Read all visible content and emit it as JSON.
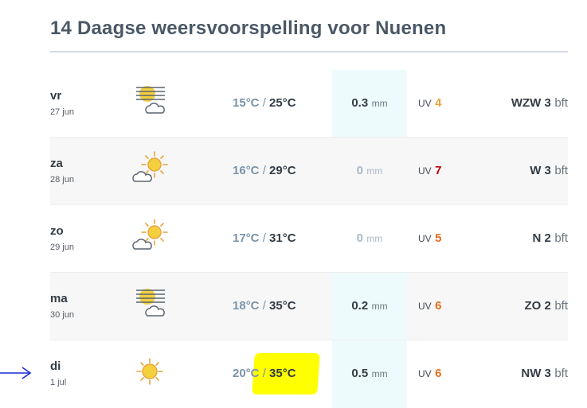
{
  "title": "14 Daagse weersvoorspelling voor Nuenen",
  "units": {
    "temp": "°C",
    "rain": "mm",
    "uv": "UV",
    "wind": "bft",
    "slash": "/"
  },
  "colors": {
    "uv_moderate": "#e8a33b",
    "uv_high": "#e07020",
    "uv_very_high": "#c0000a",
    "highlight": "#ffff00",
    "arrow": "#1c2bd6"
  },
  "days": [
    {
      "day": "vr",
      "date": "27 jun",
      "icon": "haze-cloud-icon",
      "tmin": "15",
      "tmax": "25",
      "rain": "0.3",
      "uv": "4",
      "uv_color": "#e8a33b",
      "wind": "WZW 3"
    },
    {
      "day": "za",
      "date": "28 jun",
      "icon": "sun-cloud-icon",
      "tmin": "16",
      "tmax": "29",
      "rain": "0",
      "uv": "7",
      "uv_color": "#c0000a",
      "wind": "W 3"
    },
    {
      "day": "zo",
      "date": "29 jun",
      "icon": "sun-cloud-icon",
      "tmin": "17",
      "tmax": "31",
      "rain": "0",
      "uv": "5",
      "uv_color": "#e07020",
      "wind": "N 2"
    },
    {
      "day": "ma",
      "date": "30 jun",
      "icon": "haze-cloud-icon",
      "tmin": "18",
      "tmax": "35",
      "rain": "0.2",
      "uv": "6",
      "uv_color": "#e07020",
      "wind": "ZO 2"
    },
    {
      "day": "di",
      "date": "1 jul",
      "icon": "sun-icon",
      "tmin": "20",
      "tmax": "35",
      "rain": "0.5",
      "uv": "6",
      "uv_color": "#e07020",
      "wind": "NW 3"
    }
  ]
}
